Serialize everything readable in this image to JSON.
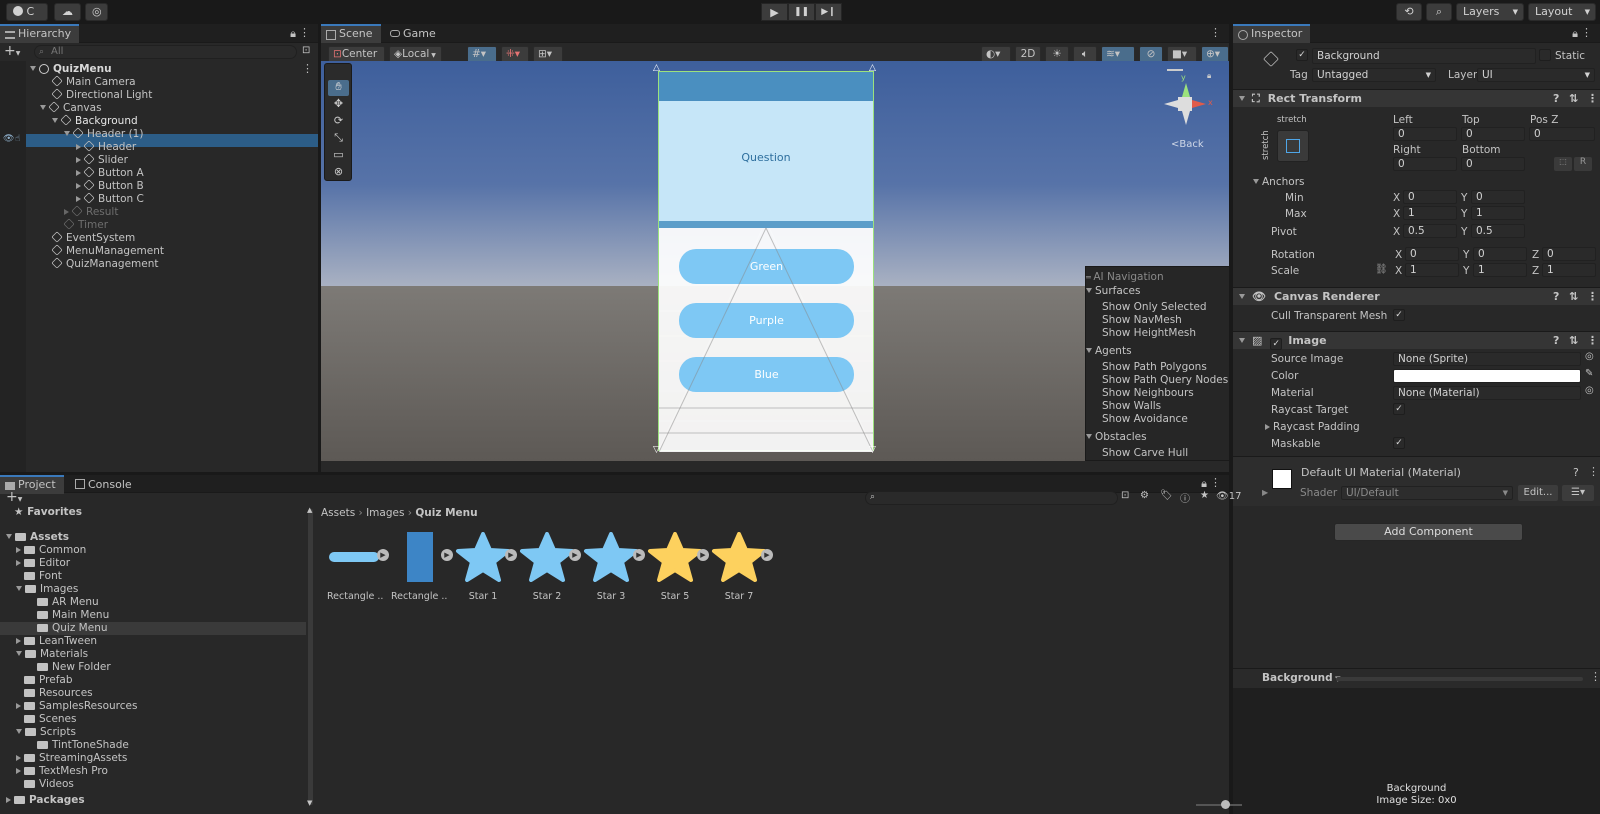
{
  "toolbar": {
    "account_label": "C",
    "layers_label": "Layers",
    "layout_label": "Layout"
  },
  "hierarchy": {
    "tab": "Hierarchy",
    "search_placeholder": "All",
    "items": [
      {
        "label": "QuizMenu"
      },
      {
        "label": "Main Camera"
      },
      {
        "label": "Directional Light"
      },
      {
        "label": "Canvas"
      },
      {
        "label": "Background"
      },
      {
        "label": "Header (1)"
      },
      {
        "label": "Header"
      },
      {
        "label": "Slider"
      },
      {
        "label": "Button A"
      },
      {
        "label": "Button B"
      },
      {
        "label": "Button C"
      },
      {
        "label": "Result"
      },
      {
        "label": "Timer"
      },
      {
        "label": "EventSystem"
      },
      {
        "label": "MenuManagement"
      },
      {
        "label": "QuizManagement"
      }
    ]
  },
  "scene": {
    "tabs": [
      "Scene",
      "Game"
    ],
    "pivot_label": "Center",
    "space_label": "Local",
    "mode_2d": "2D",
    "gizmo_back": "Back",
    "canvas": {
      "question": "Question",
      "buttons": [
        "Green",
        "Purple",
        "Blue"
      ],
      "header_color": "#4a8fc0",
      "panel_color": "#c6e6f8",
      "button_color": "#7ec8f4"
    },
    "ai_nav": {
      "title": "AI Navigation",
      "sections": [
        {
          "name": "Surfaces",
          "items": [
            {
              "label": "Show Only Selected",
              "checked": false
            },
            {
              "label": "Show NavMesh",
              "checked": true
            },
            {
              "label": "Show HeightMesh",
              "checked": false
            }
          ]
        },
        {
          "name": "Agents",
          "items": [
            {
              "label": "Show Path Polygons",
              "checked": true
            },
            {
              "label": "Show Path Query Nodes",
              "checked": false
            },
            {
              "label": "Show Neighbours",
              "checked": false
            },
            {
              "label": "Show Walls",
              "checked": false
            },
            {
              "label": "Show Avoidance",
              "checked": false
            }
          ]
        },
        {
          "name": "Obstacles",
          "items": [
            {
              "label": "Show Carve Hull",
              "checked": false
            }
          ]
        }
      ]
    }
  },
  "inspector": {
    "tab": "Inspector",
    "object_name": "Background",
    "static_label": "Static",
    "tag_label": "Tag",
    "tag_value": "Untagged",
    "layer_label": "Layer",
    "layer_value": "UI",
    "rect_transform": {
      "title": "Rect Transform",
      "anchor_top": "stretch",
      "anchor_side": "stretch",
      "left_label": "Left",
      "left": "0",
      "top_label": "Top",
      "top": "0",
      "posz_label": "Pos Z",
      "posz": "0",
      "right_label": "Right",
      "right": "0",
      "bottom_label": "Bottom",
      "bottom": "0",
      "r_label": "R",
      "anchors_label": "Anchors",
      "min_label": "Min",
      "min_x": "0",
      "min_y": "0",
      "max_label": "Max",
      "max_x": "1",
      "max_y": "1",
      "pivot_label": "Pivot",
      "pivot_x": "0.5",
      "pivot_y": "0.5",
      "rotation_label": "Rotation",
      "rot_x": "0",
      "rot_y": "0",
      "rot_z": "0",
      "scale_label": "Scale",
      "scale_x": "1",
      "scale_y": "1",
      "scale_z": "1",
      "x": "X",
      "y": "Y",
      "z": "Z"
    },
    "canvas_renderer": {
      "title": "Canvas Renderer",
      "cull_label": "Cull Transparent Mesh"
    },
    "image": {
      "title": "Image",
      "source_label": "Source Image",
      "source_value": "None (Sprite)",
      "color_label": "Color",
      "color_value": "#ffffff",
      "material_label": "Material",
      "material_value": "None (Material)",
      "raycast_label": "Raycast Target",
      "padding_label": "Raycast Padding",
      "maskable_label": "Maskable"
    },
    "material": {
      "title": "Default UI Material (Material)",
      "shader_label": "Shader",
      "shader_value": "UI/Default",
      "edit_label": "Edit..."
    },
    "add_component": "Add Component",
    "preview": {
      "dropdown": "Background",
      "caption1": "Background",
      "caption2": "Image Size: 0x0"
    }
  },
  "project": {
    "tabs": [
      "Project",
      "Console"
    ],
    "hidden_count": "17",
    "favorites": "Favorites",
    "tree": [
      {
        "label": "Assets"
      },
      {
        "label": "Common"
      },
      {
        "label": "Editor"
      },
      {
        "label": "Font"
      },
      {
        "label": "Images"
      },
      {
        "label": "AR Menu"
      },
      {
        "label": "Main Menu"
      },
      {
        "label": "Quiz Menu"
      },
      {
        "label": "LeanTween"
      },
      {
        "label": "Materials"
      },
      {
        "label": "New Folder"
      },
      {
        "label": "Prefab"
      },
      {
        "label": "Resources"
      },
      {
        "label": "SamplesResources"
      },
      {
        "label": "Scenes"
      },
      {
        "label": "Scripts"
      },
      {
        "label": "TintToneShade"
      },
      {
        "label": "StreamingAssets"
      },
      {
        "label": "TextMesh Pro"
      },
      {
        "label": "Videos"
      },
      {
        "label": "Packages"
      }
    ],
    "breadcrumb": [
      "Assets",
      "Images",
      "Quiz Menu"
    ],
    "assets": [
      {
        "label": "Rectangle ...",
        "icon": "rounded-bar"
      },
      {
        "label": "Rectangle ...",
        "icon": "tall-rectangle"
      },
      {
        "label": "Star 1",
        "icon": "star",
        "color": "#7ec8f4"
      },
      {
        "label": "Star 2",
        "icon": "star",
        "color": "#7ec8f4"
      },
      {
        "label": "Star 3",
        "icon": "star",
        "color": "#7ec8f4"
      },
      {
        "label": "Star 5",
        "icon": "star",
        "color": "#fdd15e"
      },
      {
        "label": "Star 7",
        "icon": "star",
        "color": "#fdd15e"
      }
    ]
  }
}
